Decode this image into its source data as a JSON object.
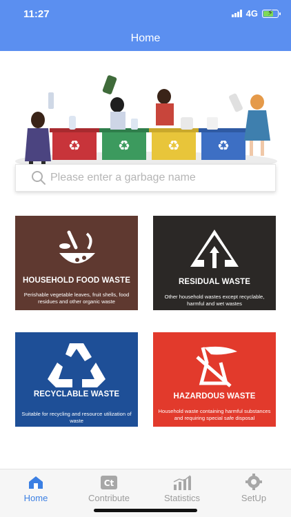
{
  "status_bar": {
    "time": "11:27",
    "network": "4G"
  },
  "header": {
    "title": "Home"
  },
  "search": {
    "placeholder": "Please enter a garbage name"
  },
  "categories": [
    {
      "title": "HOUSEHOLD FOOD WASTE",
      "description": "Perishable vegetable leaves, fruit shells, food residues and other organic waste",
      "color": "#5f3930"
    },
    {
      "title": "RESIDUAL WASTE",
      "description": "Other household wastes except recyclable, harmful and wet wastes",
      "color": "#2b2826"
    },
    {
      "title": "RECYCLABLE WASTE",
      "description": "Suitable for recycling and resource utilization of waste",
      "color": "#1e4f97"
    },
    {
      "title": "HAZARDOUS WASTE",
      "description": "Household waste containing harmful substances and requiring special safe disposal",
      "color": "#e23a2c"
    }
  ],
  "tabs": [
    {
      "label": "Home",
      "icon": "home-icon",
      "active": true
    },
    {
      "label": "Contribute",
      "icon": "contribute-icon",
      "active": false
    },
    {
      "label": "Statistics",
      "icon": "statistics-icon",
      "active": false
    },
    {
      "label": "SetUp",
      "icon": "gear-icon",
      "active": false
    }
  ],
  "colors": {
    "header": "#5b8ff0",
    "active_tab": "#3b7fe3",
    "inactive_tab": "#9b9b9b"
  }
}
